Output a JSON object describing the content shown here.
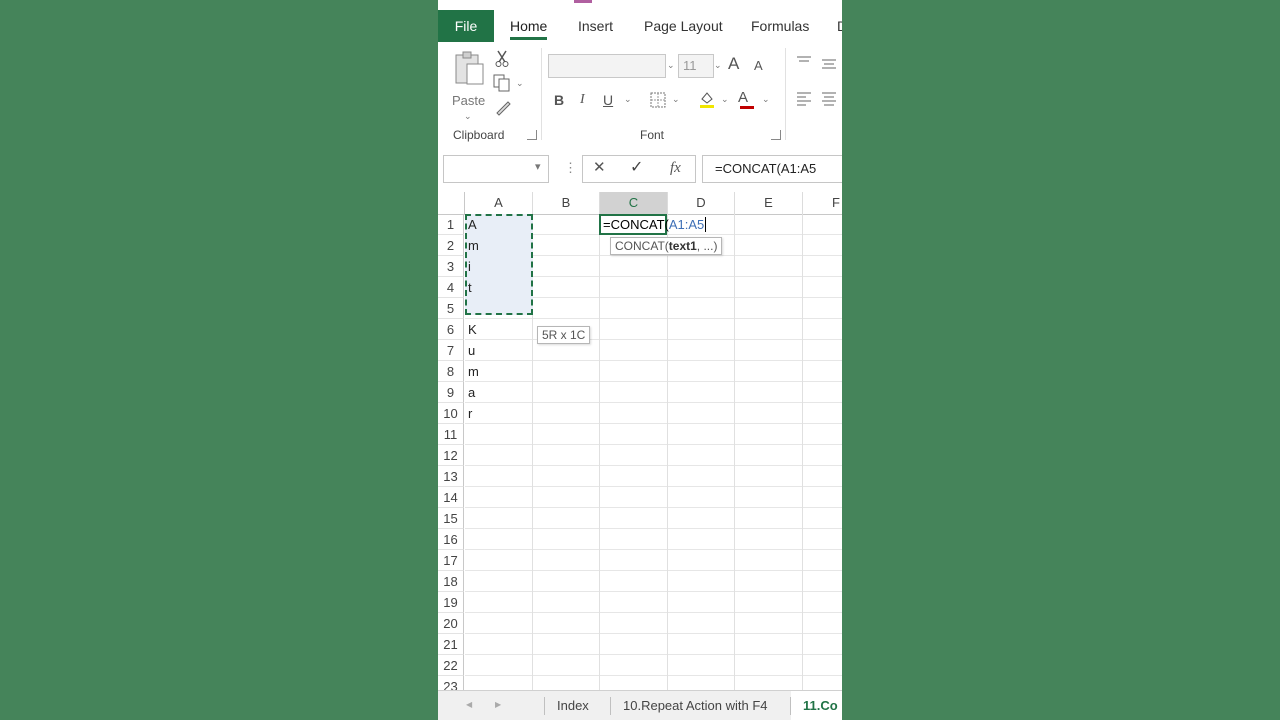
{
  "ribbon_tabs": {
    "file": "File",
    "home": "Home",
    "insert": "Insert",
    "page_layout": "Page Layout",
    "formulas": "Formulas",
    "next": "D"
  },
  "clipboard": {
    "paste_label": "Paste",
    "group_label": "Clipboard"
  },
  "font": {
    "size": "11",
    "group_label": "Font",
    "bold": "B",
    "italic": "I",
    "underline": "U",
    "grow": "A",
    "shrink": "A",
    "font_color": "A"
  },
  "formula_bar": {
    "name_box": "",
    "content": "=CONCAT(A1:A5",
    "cancel_glyph": "✕",
    "enter_glyph": "✓",
    "fx_label": "fx"
  },
  "grid": {
    "columns": [
      "A",
      "B",
      "C",
      "D",
      "E",
      "F"
    ],
    "selected_column": "C",
    "rows": [
      "1",
      "2",
      "3",
      "4",
      "5",
      "6",
      "7",
      "8",
      "9",
      "10",
      "11",
      "12",
      "13",
      "14",
      "15",
      "16",
      "17",
      "18",
      "19",
      "20",
      "21",
      "22",
      "23"
    ],
    "column_a_values": [
      "A",
      "m",
      "i",
      "t",
      "",
      "K",
      "u",
      "m",
      "a",
      "r"
    ],
    "edit_cell_prefix": "=CONCAT(",
    "edit_cell_ref": "A1:A5",
    "tooltip_func": "CONCAT(",
    "tooltip_arg": "text1",
    "tooltip_rest": ", ...)",
    "range_size_tip": "5R x 1C"
  },
  "sheets": {
    "nav_prev": "◀",
    "nav_next": "▶",
    "tabs": [
      "Index",
      "10.Repeat Action with F4",
      "11.Co"
    ]
  },
  "colors": {
    "background": "#45845a",
    "excel_green": "#217346",
    "ref_blue": "#3d6fb6"
  }
}
